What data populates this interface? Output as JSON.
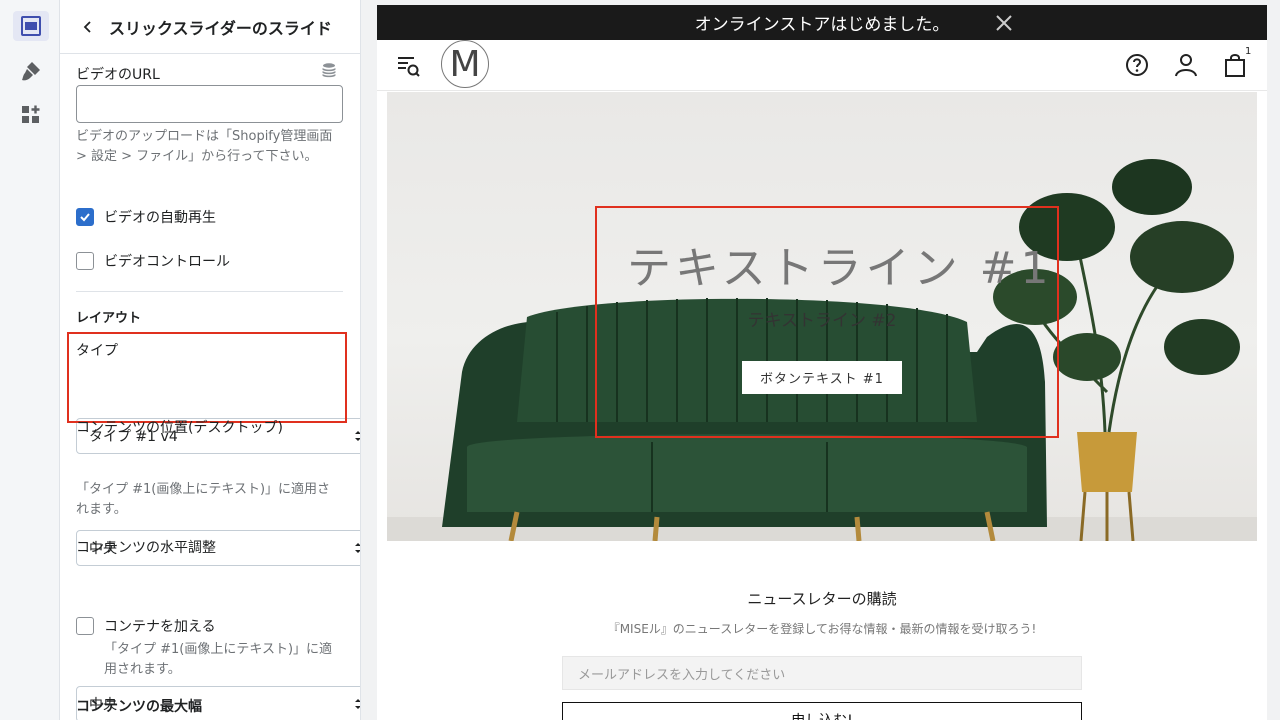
{
  "rail": {
    "items": [
      {
        "icon": "sections-icon",
        "active": true
      },
      {
        "icon": "theme-settings-icon",
        "active": false
      },
      {
        "icon": "apps-icon",
        "active": false
      }
    ]
  },
  "panel": {
    "title": "スリックスライダーのスライド",
    "video_url": {
      "label": "ビデオのURL",
      "value": "",
      "help": "ビデオのアップロードは「Shopify管理画面 > 設定 > ファイル」から行って下さい。"
    },
    "autoplay": {
      "label": "ビデオの自動再生",
      "checked": true
    },
    "controls": {
      "label": "ビデオコントロール",
      "checked": false
    },
    "layout_title": "レイアウト",
    "type": {
      "label": "タイプ",
      "value": "タイプ #1 v4"
    },
    "position": {
      "label": "コンテンツの位置(デスクトップ)",
      "value": "中央",
      "help": "「タイプ #1(画像上にテキスト)」に適用されます。"
    },
    "h_align": {
      "label": "コンテンツの水平調整",
      "value": "中央"
    },
    "container": {
      "label": "コンテナを加える",
      "checked": false,
      "help": "「タイプ #1(画像上にテキスト)」に適用されます。"
    },
    "max_width_label": "コンテンツの最大幅"
  },
  "preview": {
    "announcement": "オンラインストアはじめました。",
    "logo_letter": "M",
    "cart_count": "1",
    "hero": {
      "line1": "テキストライン #1",
      "line2": "テキストライン #2",
      "button": "ボタンテキスト #1"
    },
    "newsletter": {
      "title": "ニュースレターの購読",
      "subtitle": "『MISEル』のニュースレターを登録してお得な情報・最新の情報を受け取ろう!",
      "placeholder": "メールアドレスを入力してください",
      "button": "申し込む!"
    }
  },
  "colors": {
    "highlight": "#e0301e",
    "checkbox_accent": "#2c6ecb",
    "announcement_bar": "#1a1a1a",
    "sofa": "#1f3f2a"
  }
}
